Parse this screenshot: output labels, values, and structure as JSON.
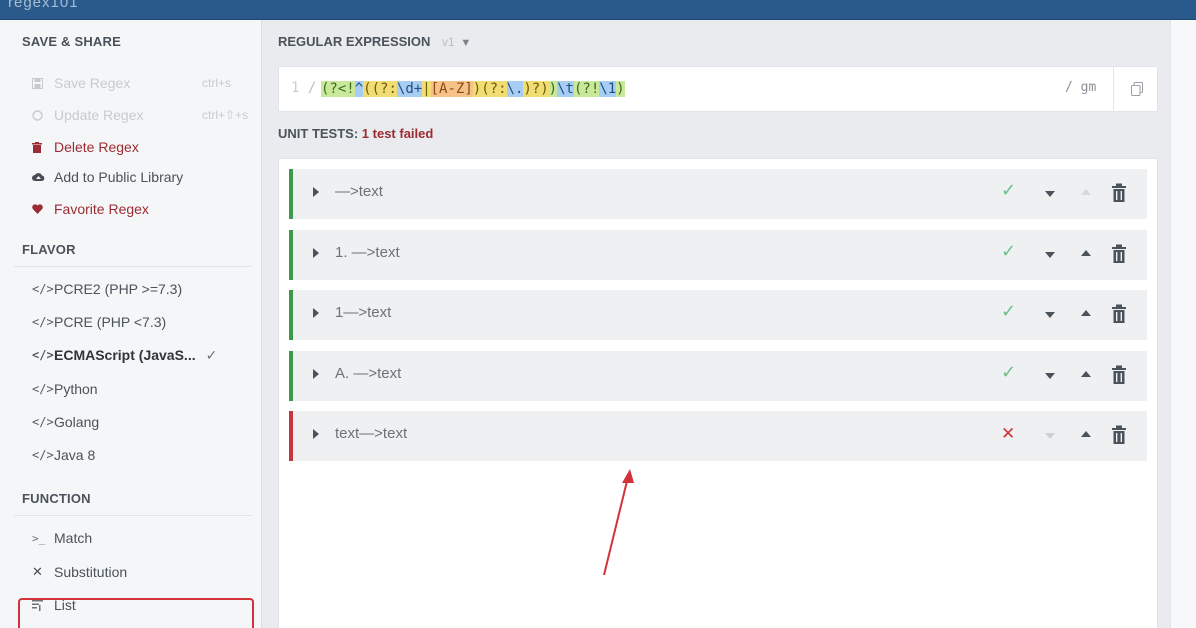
{
  "topbar": {
    "brand": "regex101",
    "right": ""
  },
  "sidebar": {
    "save_share": {
      "title": "SAVE & SHARE",
      "items": [
        {
          "label": "Save Regex",
          "shortcut": "ctrl+s"
        },
        {
          "label": "Update Regex",
          "shortcut": "ctrl+⇧+s"
        },
        {
          "label": "Delete Regex"
        },
        {
          "label": "Add to Public Library"
        },
        {
          "label": "Favorite Regex"
        }
      ]
    },
    "flavor": {
      "title": "FLAVOR",
      "items": [
        {
          "label": "PCRE2 (PHP >=7.3)"
        },
        {
          "label": "PCRE (PHP <7.3)"
        },
        {
          "label": "ECMAScript (JavaS...",
          "check": "✓"
        },
        {
          "label": "Python"
        },
        {
          "label": "Golang"
        },
        {
          "label": "Java 8"
        }
      ]
    },
    "function": {
      "title": "FUNCTION",
      "items": [
        {
          "label": "Match"
        },
        {
          "label": "Substitution"
        },
        {
          "label": "List"
        }
      ]
    }
  },
  "regex": {
    "label": "REGULAR EXPRESSION",
    "version": "v1",
    "open_delim": "/",
    "close_delim": "/",
    "flags": "gm",
    "tokens": [
      {
        "t": "(?<!",
        "c": "g"
      },
      {
        "t": "^",
        "c": "b"
      },
      {
        "t": "(",
        "c": "y"
      },
      {
        "t": "(?:",
        "c": "y"
      },
      {
        "t": "\\d+",
        "c": "b"
      },
      {
        "t": "|",
        "c": "y"
      },
      {
        "t": "[A-Z]",
        "c": "o"
      },
      {
        "t": ")",
        "c": "y"
      },
      {
        "t": "(?:",
        "c": "y"
      },
      {
        "t": "\\.",
        "c": "b"
      },
      {
        "t": ")?",
        "c": "y"
      },
      {
        "t": ")",
        "c": "y"
      },
      {
        "t": ")",
        "c": "g"
      },
      {
        "t": "\\t",
        "c": "b"
      },
      {
        "t": "(?!",
        "c": "g"
      },
      {
        "t": "\\1",
        "c": "b"
      },
      {
        "t": ")",
        "c": "g"
      }
    ]
  },
  "unit_tests": {
    "label": "UNIT TESTS:",
    "summary": "1 test failed",
    "tests": [
      {
        "label": "—>text",
        "status": "pass",
        "down_dim": false,
        "up_dim": true
      },
      {
        "label": "1. —>text",
        "status": "pass",
        "down_dim": false,
        "up_dim": false
      },
      {
        "label": "1—>text",
        "status": "pass",
        "down_dim": false,
        "up_dim": false
      },
      {
        "label": "A. —>text",
        "status": "pass",
        "down_dim": false,
        "up_dim": false
      },
      {
        "label": "text—>text",
        "status": "fail",
        "down_dim": true,
        "up_dim": false
      }
    ]
  },
  "colors": {
    "pass": "#6cc08a",
    "fail": "#d2323a",
    "accent_bar": "#2a5a8c"
  }
}
